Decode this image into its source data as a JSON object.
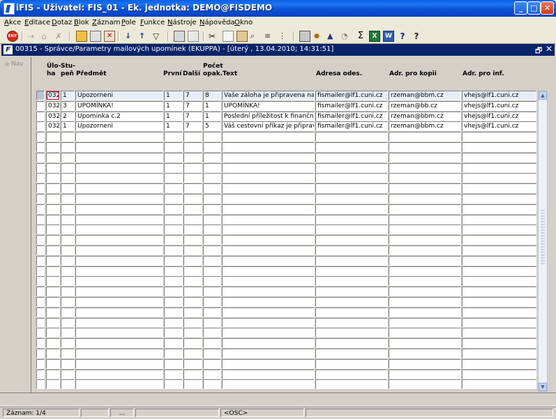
{
  "window": {
    "title": "iFIS - Uživatel: FIS_01 - Ek. jednotka: DEMO@FISDEMO",
    "minimize_label": "_",
    "maximize_label": "□",
    "close_label": "✕"
  },
  "menu": [
    "Akce",
    "Editace",
    "Dotaz",
    "Blok",
    "Záznam",
    "Pole",
    "Funkce",
    "Nástroje",
    "Nápověda",
    "Okno"
  ],
  "toolbar": {
    "exit_label": "EXIT",
    "icons": [
      "exit-icon",
      "save-icon",
      "print-icon",
      "cancel-icon",
      "record-new-icon",
      "record-copy-icon",
      "record-delete-icon",
      "sort-asc-icon",
      "sort-desc-icon",
      "filter-icon",
      "printer-icon",
      "export-icon",
      "cut-icon",
      "copy-icon",
      "paste-icon",
      "find-icon",
      "list-icon",
      "columns-icon",
      "calculator-icon",
      "gear-icon",
      "warning-icon",
      "chart-icon",
      "sum-icon",
      "excel-icon",
      "word-icon",
      "help-icon",
      "help-question-icon"
    ]
  },
  "child_window": {
    "icon_label": "F",
    "title": "00315 - Správce/Parametry mailových upomínek (EKUPPA) - [úterý , 13.04.2010; 14:31:51]",
    "restore_label": "🗗",
    "close_label": "✕"
  },
  "nav": {
    "label": "Nav"
  },
  "columns": {
    "uloha": [
      "Úlo-",
      "ha"
    ],
    "stupen": [
      "Stu-",
      "peň"
    ],
    "predmet": "Předmět",
    "prvni": "První",
    "dalsi": "Další",
    "pocet": [
      "Počet",
      "opak."
    ],
    "text": "Text",
    "adresa": "Adresa odes.",
    "kopie": "Adr. pro kopii",
    "inf": "Adr. pro inf."
  },
  "rows": [
    {
      "uloha": "032",
      "stupen": "1",
      "predmet": "Upozorneni",
      "prvni": "1",
      "dalsi": "7",
      "pocet": "8",
      "text": "Vaše záloha  je připravena na pokl",
      "adresa": "fismailer@lf1.cuni.cz",
      "kopie": "rzeman@bbm.cz",
      "inf": "vhejs@lf1.cuni.cz"
    },
    {
      "uloha": "032",
      "stupen": "3",
      "predmet": "UPOMÍNKA!",
      "prvni": "1",
      "dalsi": "7",
      "pocet": "1",
      "text": "UPOMÍNKA!",
      "adresa": "fismailer@lf1.cuni.cz",
      "kopie": "rzeman@bb.cz",
      "inf": "vhejs@lf1.cuni.cz"
    },
    {
      "uloha": "032",
      "stupen": "2",
      "predmet": "Upominka c.2",
      "prvni": "1",
      "dalsi": "7",
      "pocet": "1",
      "text": "Poslední příležitost k finančnímu vy",
      "adresa": "fismailer@lf1.cuni.cz",
      "kopie": "rzeman@bbm.cz",
      "inf": "vhejs@lf1.cuni.cz"
    },
    {
      "uloha": "032",
      "stupen": "1",
      "predmet": "Upozorneni",
      "prvni": "1",
      "dalsi": "7",
      "pocet": "5",
      "text": "Váš cestovní příkaz je připraven na",
      "adresa": "fismailer@lf1.cuni.cz",
      "kopie": "rzeman@bbm.cz",
      "inf": "vhejs@lf1.cuni.cz"
    }
  ],
  "status": {
    "record": "Záznam: 1/4",
    "dots": "...",
    "mode": "<OSC>"
  }
}
